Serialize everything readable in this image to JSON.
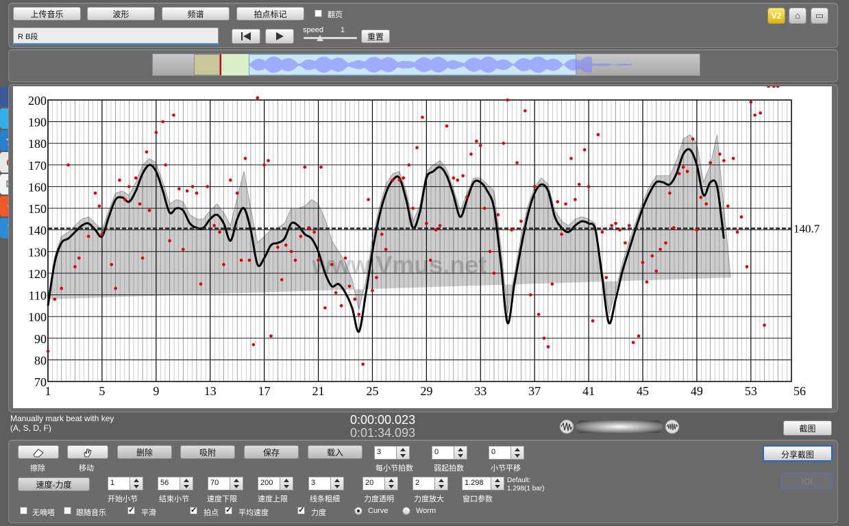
{
  "toolbar": {
    "upload_label": "上传音乐",
    "waveform_label": "波形",
    "spectrum_label": "频谱",
    "beat_mark_label": "拍点标记",
    "flip_page_label": "翻页",
    "v2_label": "V2"
  },
  "segment": {
    "name": "R B段"
  },
  "playback": {
    "speed_label": "speed",
    "speed_value": "1",
    "reset_label": "重置"
  },
  "chart_data": {
    "type": "line",
    "x_ticks": [
      "1",
      "5",
      "9",
      "13",
      "17",
      "21",
      "25",
      "29",
      "33",
      "37",
      "41",
      "45",
      "49",
      "53",
      "56"
    ],
    "y_ticks": [
      "200",
      "190",
      "180",
      "170",
      "160",
      "150",
      "140",
      "130",
      "120",
      "110",
      "100",
      "90",
      "80",
      "70"
    ],
    "xlim": [
      1,
      56
    ],
    "ylim": [
      70,
      200
    ],
    "mean_value": "140.7",
    "watermark": "www.Vmus.net",
    "curve_x": [
      1,
      1.5,
      2,
      2.5,
      3,
      3.5,
      4,
      4.5,
      5,
      5.5,
      6,
      6.5,
      7,
      7.5,
      8,
      8.5,
      9,
      9.5,
      10,
      10.5,
      11,
      11.5,
      12,
      12.5,
      13,
      13.5,
      14,
      14.5,
      15,
      15.5,
      16,
      16.5,
      17,
      17.5,
      18,
      18.5,
      19,
      19.5,
      20,
      20.5,
      21,
      21.5,
      22,
      22.5,
      23,
      23.5,
      24,
      24.5,
      25,
      25.5,
      26,
      26.5,
      27,
      27.5,
      28,
      28.5,
      29,
      29.5,
      30,
      30.5,
      31,
      31.5,
      32,
      32.5,
      33,
      33.5,
      34,
      34.5,
      35,
      35.5,
      36,
      36.5,
      37,
      37.5,
      38,
      38.5,
      39,
      39.5,
      40,
      40.5,
      41,
      41.5,
      42,
      42.5,
      43,
      43.5,
      44,
      44.5,
      45,
      45.5,
      46,
      46.5,
      47,
      47.5,
      48,
      48.5,
      49,
      49.5,
      50,
      50.5,
      51,
      51.5,
      52,
      52.5,
      53,
      53.5,
      54,
      54.5,
      55
    ],
    "curve_y": [
      105,
      125,
      134,
      136,
      139,
      142,
      143,
      140,
      137,
      146,
      154,
      155,
      153,
      158,
      166,
      170,
      167,
      158,
      148,
      150,
      149,
      143,
      141,
      141,
      145,
      147,
      143,
      135,
      145,
      150,
      140,
      124,
      127,
      133,
      134,
      136,
      143,
      142,
      138,
      136,
      130,
      120,
      114,
      115,
      111,
      104,
      93,
      110,
      130,
      146,
      157,
      163,
      164,
      154,
      141,
      148,
      164,
      167,
      169,
      165,
      156,
      146,
      154,
      162,
      162,
      158,
      150,
      125,
      97,
      115,
      132,
      147,
      157,
      161,
      158,
      146,
      141,
      139,
      142,
      144,
      143,
      140,
      118,
      97,
      108,
      121,
      131,
      141,
      150,
      157,
      162,
      162,
      161,
      166,
      175,
      177,
      170,
      156,
      162,
      160,
      136,
      112
    ],
    "band_upper": [
      108,
      128,
      137,
      139,
      142,
      145,
      146,
      143,
      140,
      149,
      157,
      158,
      156,
      162,
      170,
      173,
      171,
      162,
      152,
      154,
      153,
      147,
      145,
      145,
      149,
      152,
      148,
      142,
      155,
      167,
      150,
      134,
      137,
      140,
      141,
      143,
      150,
      150,
      151,
      154,
      152,
      145,
      135,
      130,
      125,
      117,
      103,
      116,
      136,
      150,
      161,
      166,
      167,
      158,
      144,
      151,
      167,
      170,
      172,
      168,
      159,
      149,
      157,
      164,
      164,
      161,
      158,
      133,
      101,
      119,
      137,
      151,
      160,
      164,
      161,
      149,
      144,
      142,
      145,
      146,
      145,
      143,
      122,
      101,
      112,
      125,
      135,
      144,
      153,
      160,
      165,
      165,
      165,
      172,
      182,
      184,
      180,
      162,
      170,
      184,
      150,
      118
    ],
    "band_lower": [
      102,
      122,
      131,
      133,
      136,
      139,
      140,
      137,
      134,
      143,
      151,
      152,
      150,
      154,
      162,
      167,
      163,
      154,
      144,
      146,
      145,
      139,
      137,
      137,
      141,
      142,
      138,
      128,
      135,
      133,
      130,
      114,
      117,
      126,
      127,
      129,
      136,
      134,
      125,
      118,
      108,
      95,
      93,
      100,
      97,
      91,
      84,
      104,
      124,
      142,
      153,
      160,
      161,
      150,
      138,
      145,
      161,
      164,
      166,
      162,
      153,
      143,
      151,
      160,
      160,
      155,
      142,
      117,
      93,
      111,
      127,
      143,
      154,
      158,
      155,
      143,
      138,
      136,
      139,
      142,
      141,
      137,
      114,
      93,
      104,
      117,
      127,
      138,
      147,
      154,
      159,
      159,
      157,
      160,
      168,
      170,
      160,
      150,
      154,
      136,
      122,
      106
    ],
    "points_x": [
      1,
      1.5,
      2,
      2.5,
      3,
      3.3,
      4,
      4.5,
      4.8,
      5,
      5.7,
      6,
      6.3,
      6.7,
      7,
      7.5,
      7.8,
      8,
      8.3,
      8.5,
      9,
      9.5,
      9.7,
      10,
      10.3,
      10.7,
      11,
      11.3,
      11.7,
      12,
      12.3,
      12.8,
      13.3,
      13.7,
      14,
      14.5,
      15,
      15.3,
      15.6,
      15.9,
      16.2,
      16.5,
      17,
      17.3,
      17.5,
      18,
      18.3,
      18.6,
      19,
      19.3,
      19.7,
      20,
      20.3,
      20.7,
      21,
      21.2,
      21.5,
      22,
      22.3,
      22.7,
      23,
      23.3,
      23.7,
      24,
      24.3,
      24.7,
      25,
      25.3,
      25.7,
      26,
      26.5,
      27,
      27.3,
      27.7,
      28,
      28.3,
      28.7,
      29,
      29.3,
      29.7,
      30,
      30.5,
      31,
      31.3,
      31.7,
      32,
      32.3,
      32.7,
      33,
      33.3,
      33.7,
      34,
      34.3,
      34.7,
      35,
      35.3,
      35.7,
      36,
      36.3,
      36.7,
      37,
      37.3,
      37.7,
      38,
      38.3,
      38.7,
      39,
      39.3,
      39.7,
      40,
      40.3,
      40.7,
      41,
      41.3,
      41.7,
      42,
      42.3,
      42.7,
      43,
      43.3,
      43.7,
      44,
      44.3,
      44.7,
      45,
      45.3,
      45.7,
      46,
      46.3,
      46.7,
      47,
      47.3,
      47.7,
      48,
      48.3,
      48.7,
      49,
      49.3,
      49.7,
      50,
      50.3,
      50.7,
      51,
      51.3,
      51.7,
      52,
      52.3,
      52.7,
      53,
      53.3,
      53.7,
      54,
      54.3,
      54.7,
      55
    ],
    "points_y": [
      84,
      108,
      113,
      170,
      123,
      127,
      137,
      157,
      151,
      138,
      124,
      113,
      163,
      154,
      160,
      164,
      152,
      127,
      176,
      149,
      185,
      190,
      170,
      135,
      193,
      159,
      131,
      158,
      160,
      157,
      115,
      160,
      142,
      139,
      124,
      163,
      157,
      126,
      173,
      126,
      87,
      201,
      170,
      172,
      91,
      132,
      117,
      133,
      130,
      126,
      137,
      169,
      141,
      139,
      126,
      169,
      104,
      124,
      111,
      105,
      127,
      114,
      108,
      101,
      78,
      154,
      112,
      118,
      138,
      131,
      163,
      163,
      164,
      170,
      150,
      178,
      192,
      143,
      126,
      140,
      142,
      188,
      164,
      163,
      165,
      155,
      175,
      181,
      179,
      150,
      130,
      120,
      147,
      180,
      200,
      140,
      171,
      144,
      195,
      110,
      160,
      101,
      90,
      86,
      115,
      153,
      138,
      152,
      173,
      154,
      161,
      177,
      160,
      98,
      184,
      139,
      118,
      142,
      143,
      140,
      134,
      142,
      88,
      91,
      125,
      116,
      128,
      121,
      131,
      134,
      157,
      141,
      166,
      169,
      167,
      182,
      140,
      155,
      152,
      171,
      209,
      175,
      172,
      151,
      173,
      139,
      146,
      123,
      199,
      193,
      194,
      96
    ]
  },
  "status": {
    "hint_line1": "Manually mark beat with key",
    "hint_line2": "(A, S, D, F)",
    "time_current": "0:00:00.023",
    "time_total": "0:01:34.093",
    "screenshot_label": "截图"
  },
  "controls": {
    "eraser_label": "擦除",
    "move_label": "移动",
    "delete_label": "删除",
    "snap_label": "吸附",
    "save_label": "保存",
    "load_label": "载入",
    "beats_per_bar": {
      "value": "3",
      "label": "每小节拍数"
    },
    "pickup_beats": {
      "value": "0",
      "label": "弱起拍数"
    },
    "bar_shift": {
      "value": "0",
      "label": "小节平移"
    },
    "share_screenshot_label": "分享截图",
    "ioi_label": "IOI",
    "mode_label": "速度-力度",
    "start_bar": {
      "value": "1",
      "label": "开始小节"
    },
    "end_bar": {
      "value": "56",
      "label": "结束小节"
    },
    "tempo_min": {
      "value": "70",
      "label": "速度下限"
    },
    "tempo_max": {
      "value": "200",
      "label": "速度上限"
    },
    "line_width": {
      "value": "3",
      "label": "线条粗细"
    },
    "dynamic_opacity": {
      "value": "20",
      "label": "力度透明"
    },
    "dynamic_scale": {
      "value": "2",
      "label": "力度放大"
    },
    "window_param": {
      "value": "1.298",
      "label": "窗口参数"
    },
    "default_line1": "Default:",
    "default_line2": "1.298(1 bar)",
    "check_metronome": "无嘀嗒",
    "check_follow": "跟随音乐",
    "check_smooth": "平滑",
    "check_beat": "拍点",
    "check_avg_tempo": "平均速度",
    "check_dynamics": "力度",
    "radio_curve": "Curve",
    "radio_worm": "Worm"
  }
}
